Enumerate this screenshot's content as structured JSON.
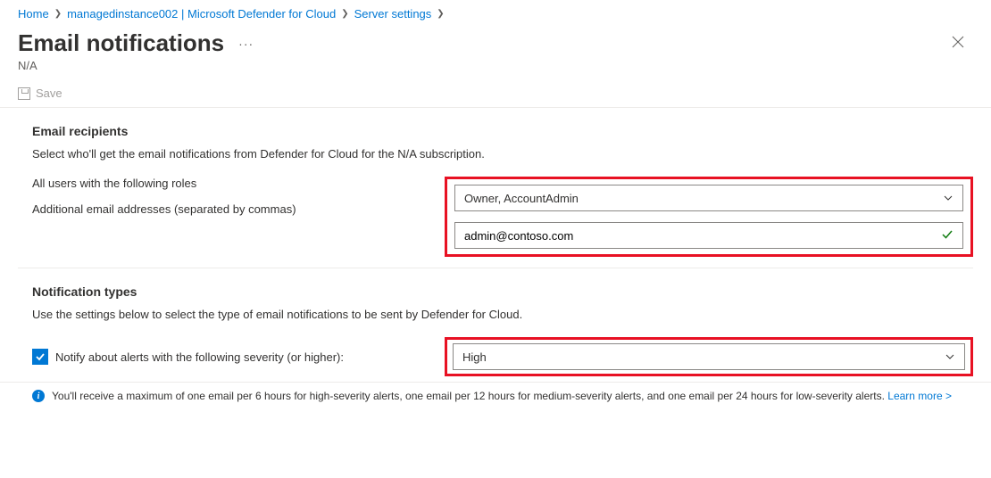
{
  "breadcrumb": {
    "items": [
      {
        "label": "Home"
      },
      {
        "label": "managedinstance002 | Microsoft Defender for Cloud"
      },
      {
        "label": "Server settings"
      }
    ]
  },
  "header": {
    "title": "Email notifications",
    "subtitle": "N/A"
  },
  "toolbar": {
    "save_label": "Save"
  },
  "recipients": {
    "title": "Email recipients",
    "description": "Select who'll get the email notifications from Defender for Cloud for the N/A subscription.",
    "roles_label": "All users with the following roles",
    "roles_value": "Owner, AccountAdmin",
    "emails_label": "Additional email addresses (separated by commas)",
    "emails_value": "admin@contoso.com"
  },
  "notifications": {
    "title": "Notification types",
    "description": "Use the settings below to select the type of email notifications to be sent by Defender for Cloud.",
    "severity_label": "Notify about alerts with the following severity (or higher):",
    "severity_value": "High"
  },
  "info": {
    "text": "You'll receive a maximum of one email per 6 hours for high-severity alerts, one email per 12 hours for medium-severity alerts, and one email per 24 hours for low-severity alerts.",
    "learn_more": "Learn more >"
  }
}
